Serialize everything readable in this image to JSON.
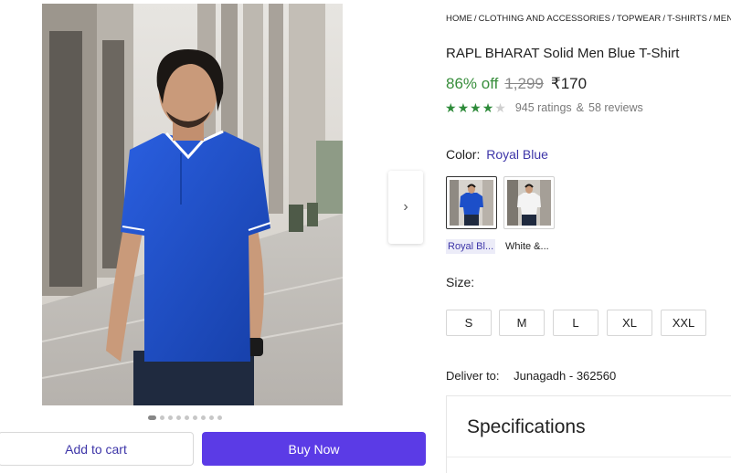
{
  "gallery": {
    "next_icon": "chevron-right-icon",
    "dots_total": 9,
    "dot_active_index": 0
  },
  "actions": {
    "add_to_cart": "Add to cart",
    "buy_now": "Buy Now",
    "buy_now_color": "#5b3be6"
  },
  "breadcrumb": [
    "HOME",
    "CLOTHING AND ACCESSORIES",
    "TOPWEAR",
    "T-SHIRTS",
    "MEN'S T"
  ],
  "product": {
    "title": "RAPL BHARAT Solid Men Blue T-Shirt",
    "discount": "86% off",
    "mrp": "1,299",
    "price": "₹170",
    "rating_stars": 4,
    "ratings": "945 ratings",
    "amp": "&",
    "reviews": "58 reviews"
  },
  "color": {
    "label": "Color:",
    "selected": "Royal Blue",
    "options": [
      {
        "label": "Royal Bl...",
        "shirt_color": "#1c4fc9"
      },
      {
        "label": "White &...",
        "shirt_color": "#f4f4f4"
      }
    ]
  },
  "size": {
    "label": "Size:",
    "options": [
      "S",
      "M",
      "L",
      "XL",
      "XXL"
    ]
  },
  "delivery": {
    "label": "Deliver to:",
    "location": "Junagadh - 362560"
  },
  "specifications": {
    "title": "Specifications"
  },
  "colors": {
    "accent": "#3d35a8",
    "discount_green": "#388e3c",
    "star_green": "#2e8b3a"
  }
}
